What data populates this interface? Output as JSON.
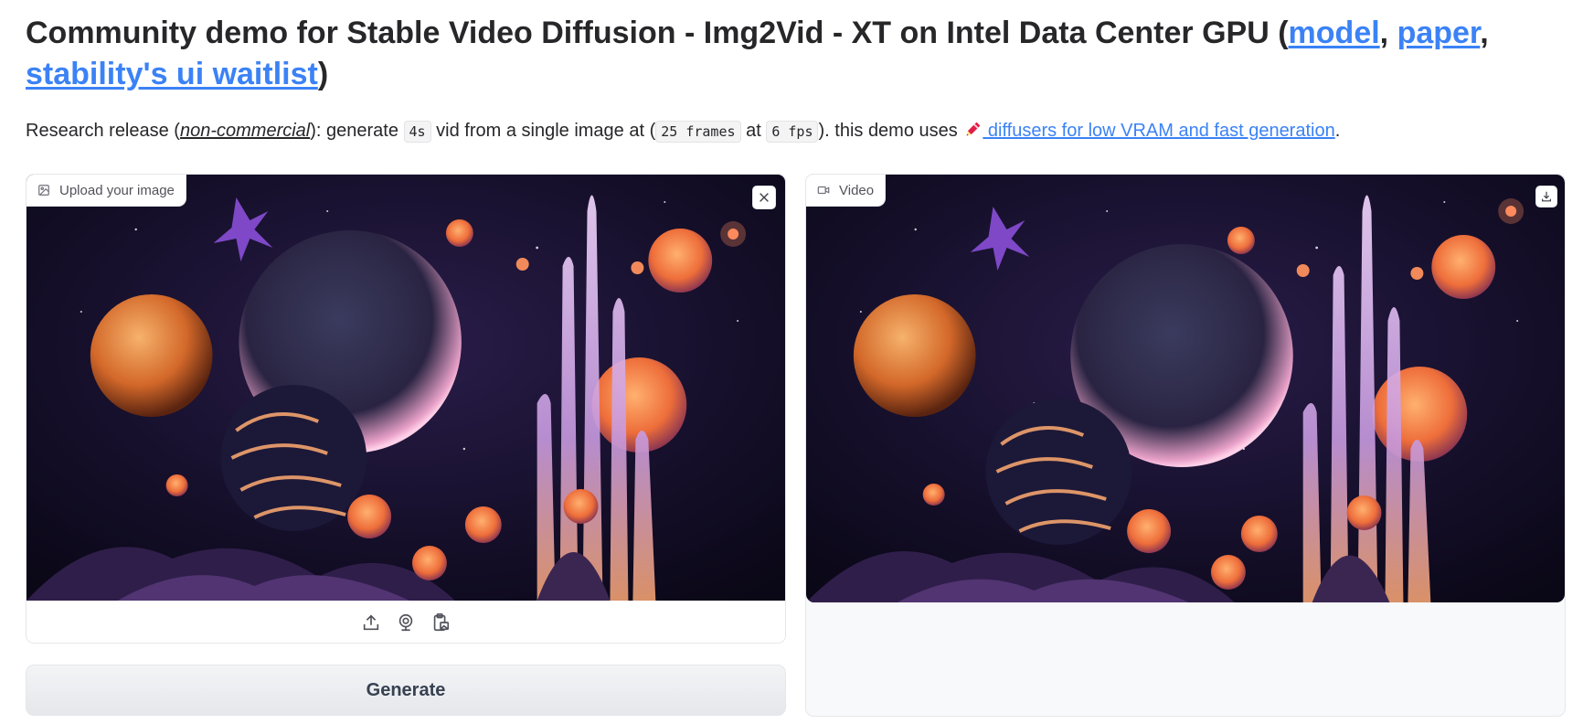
{
  "header": {
    "title_text": "Community demo for Stable Video Diffusion - Img2Vid - XT on Intel Data Center GPU (",
    "link_model": "model",
    "sep1": ", ",
    "link_paper": "paper",
    "sep2": ", ",
    "link_stability": "stability's ui waitlist",
    "title_close": ")"
  },
  "description": {
    "part1": "Research release (",
    "non_commercial": "non-commercial",
    "part2": "): generate ",
    "code_duration": "4s",
    "part3": " vid from a single image at (",
    "code_frames": "25 frames",
    "part4": " at ",
    "code_fps": "6 fps",
    "part5": "). this demo uses ",
    "diffusers_link": "diffusers for low VRAM and fast generation",
    "part6": "."
  },
  "input_panel": {
    "label": "Upload your image",
    "icons": [
      "image-icon",
      "close-icon",
      "upload-icon",
      "webcam-icon",
      "clipboard-icon"
    ]
  },
  "output_panel": {
    "label": "Video",
    "icons": [
      "video-icon",
      "download-icon"
    ]
  },
  "generate_button": {
    "label": "Generate"
  },
  "colors": {
    "link": "#3b82f6",
    "text": "#27272a",
    "button_bg": "#f3f4f6"
  }
}
